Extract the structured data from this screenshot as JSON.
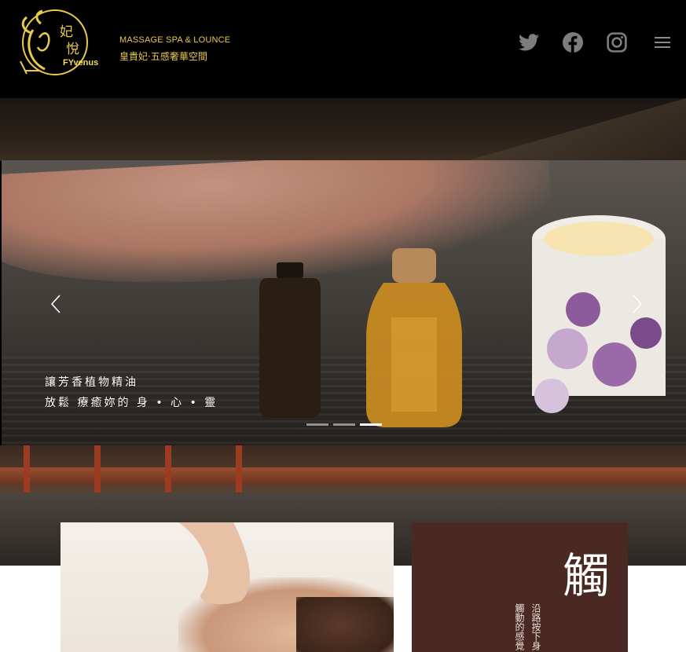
{
  "header": {
    "logo_brand": "FYvenus",
    "logo_tagline_en": "MASSAGE SPA & LOUNCE",
    "logo_tagline_zh": "皇貴妃·五感奢華空間",
    "icons": [
      "twitter-icon",
      "facebook-icon",
      "instagram-icon",
      "menu-icon"
    ]
  },
  "slider": {
    "caption_line1": "讓芳香植物精油",
    "caption_line2": "放鬆 療癒妳的 身 • 心 • 靈",
    "slide_count": 3,
    "active_index": 2
  },
  "feature_card": {
    "glyph": "觸",
    "col1": "沿路按下身",
    "col2": "觸動的感覺"
  },
  "colors": {
    "gold": "#e9c94a",
    "card_brown": "#4a2923",
    "header_bg": "#000000"
  }
}
